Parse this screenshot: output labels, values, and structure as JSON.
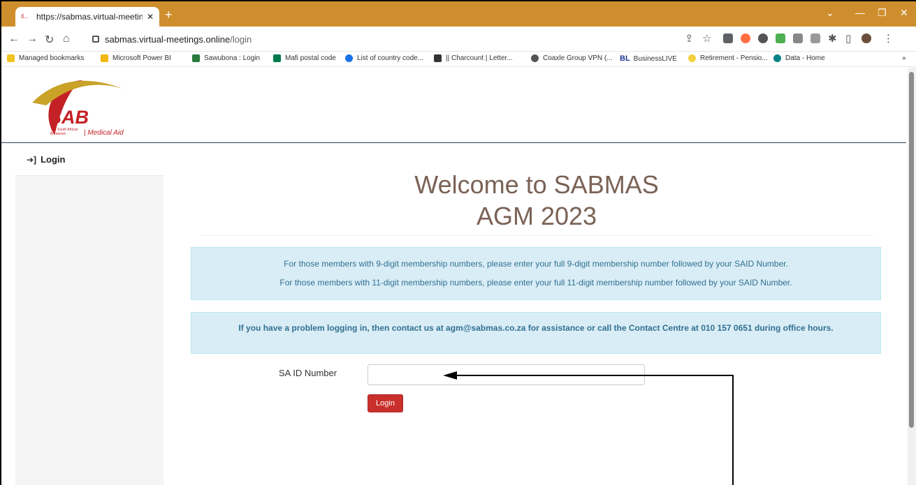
{
  "browser": {
    "tab_title": "https://sabmas.virtual-meetings.c",
    "favicon_text": "6...",
    "new_tab_glyph": "+",
    "url_host": "sabmas.virtual-meetings.online",
    "url_path": "/login",
    "accent_color": "#cf8e2e"
  },
  "bookmarks": [
    {
      "label": "Managed bookmarks",
      "color": "#f0c420"
    },
    {
      "label": "Microsoft Power BI",
      "color": "#f2b80f"
    },
    {
      "label": "Sawubona : Login",
      "color": "#2a7a3b"
    },
    {
      "label": "Mafi postal code",
      "color": "#007a4d"
    },
    {
      "label": "List of country code...",
      "color": "#1a73e8"
    },
    {
      "label": "|| Charcount | Letter...",
      "color": "#333333"
    },
    {
      "label": "Coaxle Group VPN (...",
      "color": "#555555"
    },
    {
      "label": "BusinessLIVE",
      "color": "#1f3a93",
      "prefix": "BL"
    },
    {
      "label": "Retirement - Pensio...",
      "color": "#f4d03f"
    },
    {
      "label": "Data - Home",
      "color": "#038387"
    }
  ],
  "bookmarks_overflow": "»",
  "logo": {
    "main": "SAB",
    "line1": "The South African",
    "line2": "Breweries",
    "tagline": "| Medical Aid"
  },
  "sidebar": {
    "items": [
      {
        "label": "Login",
        "icon": "sign-in-icon"
      }
    ]
  },
  "main": {
    "title_line1": "Welcome to SABMAS",
    "title_line2": "AGM 2023",
    "info_line1": "For those members with 9-digit membership numbers, please enter your full 9-digit membership number followed by your SAID Number.",
    "info_line2": "For those members with 11-digit membership numbers, please enter your full 11-digit membership number followed by your SAID Number.",
    "contact_note": "If you have a problem logging in, then contact us at agm@sabmas.co.za for assistance or call the Contact Centre at 010 157 0651 during office hours.",
    "form": {
      "id_label": "SA ID Number",
      "id_value": "",
      "id_placeholder": "",
      "submit_label": "Login"
    }
  }
}
